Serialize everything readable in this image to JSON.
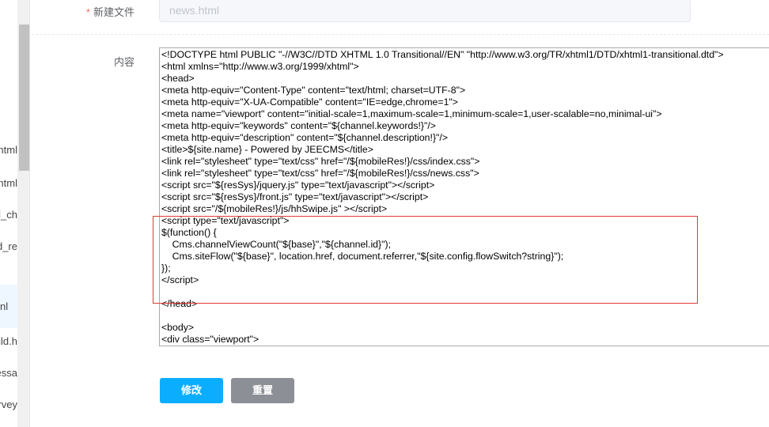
{
  "sidebar": {
    "items": [
      {
        "label": "d.html"
      },
      {
        "label": "d.html"
      },
      {
        "label": "d_ch"
      },
      {
        "label": "d_re"
      },
      {
        "label": "nl",
        "active": true
      },
      {
        "label": "ild.h"
      },
      {
        "label": "essa"
      },
      {
        "label": "rvey"
      }
    ]
  },
  "form": {
    "filename_label": "新建文件",
    "required_mark": "*",
    "filename_value": "news.html",
    "content_label": "内容",
    "content_lines": [
      "<!DOCTYPE html PUBLIC \"-//W3C//DTD XHTML 1.0 Transitional//EN\" \"http://www.w3.org/TR/xhtml1/DTD/xhtml1-transitional.dtd\">",
      "<html xmlns=\"http://www.w3.org/1999/xhtml\">",
      "<head>",
      "<meta http-equiv=\"Content-Type\" content=\"text/html; charset=UTF-8\">",
      "<meta http-equiv=\"X-UA-Compatible\" content=\"IE=edge,chrome=1\">",
      "<meta name=\"viewport\" content=\"initial-scale=1,maximum-scale=1,minimum-scale=1,user-scalable=no,minimal-ui\">",
      "<meta http-equiv=\"keywords\" content=\"${channel.keywords!}\"/>",
      "<meta http-equiv=\"description\" content=\"${channel.description!}\"/>",
      "<title>${site.name} - Powered by JEECMS</title>",
      "<link rel=\"stylesheet\" type=\"text/css\" href=\"/${mobileRes!}/css/index.css\">",
      "<link rel=\"stylesheet\" type=\"text/css\" href=\"/${mobileRes!}/css/news.css\">",
      "<script src=\"${resSys}/jquery.js\" type=\"text/javascript\"></script>",
      "<script src=\"${resSys}/front.js\" type=\"text/javascript\"></script>",
      "<script src=\"/${mobileRes!}/js/hhSwipe.js\" ></script>",
      "<script type=\"text/javascript\">",
      "$(function() {",
      "\tCms.channelViewCount(\"${base}\",\"${channel.id}\");",
      "\tCms.siteFlow(\"${base}\", location.href, document.referrer,\"${site.config.flowSwitch?string}\");",
      "});",
      "</script>",
      "",
      "</head>",
      "",
      "<body>",
      "<div class=\"viewport\">"
    ],
    "submit_label": "修改",
    "reset_label": "重置"
  }
}
